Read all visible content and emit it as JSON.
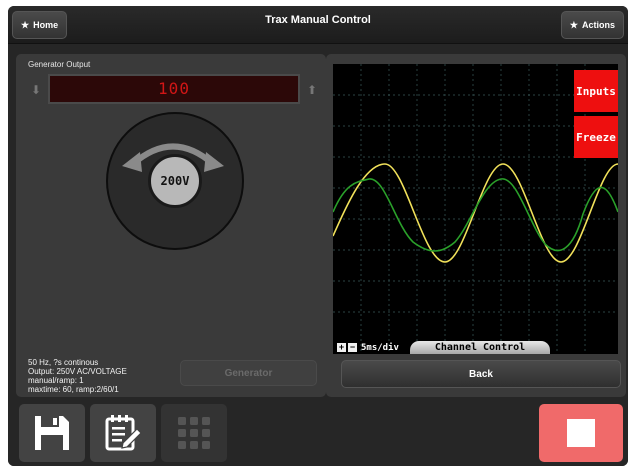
{
  "header": {
    "title": "Trax Manual Control",
    "home_label": "Home",
    "actions_label": "Actions"
  },
  "generator": {
    "section_label": "Generator Output",
    "display_value": "100",
    "dial_value": "200V",
    "button_label": "Generator",
    "status_lines": [
      "50 Hz, ?s continous",
      "Output: 250V AC/VOLTAGE",
      "manual/ramp: 1",
      "maxtime: 60, ramp:2/60/1"
    ]
  },
  "scope": {
    "inputs_label": "Inputs",
    "freeze_label": "Freeze",
    "timebase_label": "5ms/div",
    "channel_tab_label": "Channel Control",
    "plus_label": "+",
    "minus_label": "−",
    "trace_colors": {
      "yellow": "#f1e15a",
      "green": "#2aa02a"
    }
  },
  "back_label": "Back",
  "icons": {
    "home": "star-icon",
    "actions": "star-icon",
    "save": "floppy-disk-icon",
    "notes": "notepad-pencil-icon",
    "grid": "grid-icon",
    "stop": "stop-icon"
  }
}
